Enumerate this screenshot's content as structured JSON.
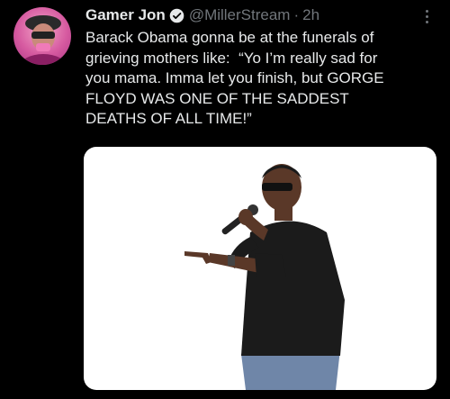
{
  "tweet": {
    "display_name": "Gamer Jon",
    "handle": "@MillerStream",
    "separator": "·",
    "time": "2h",
    "text": "Barack Obama gonna be at the funerals of\ngrieving mothers like:  “Yo I’m really sad for\nyou mama. Imma let you finish, but GORGE\nFLOYD WAS ONE OF THE SADDEST\nDEATHS OF ALL TIME!”",
    "verified_icon": "verified-badge-icon",
    "more_icon": "more-options-icon"
  },
  "colors": {
    "background": "#000000",
    "name": "#e7e9ea",
    "meta": "#71767b",
    "avatar": "#d65aa0"
  }
}
